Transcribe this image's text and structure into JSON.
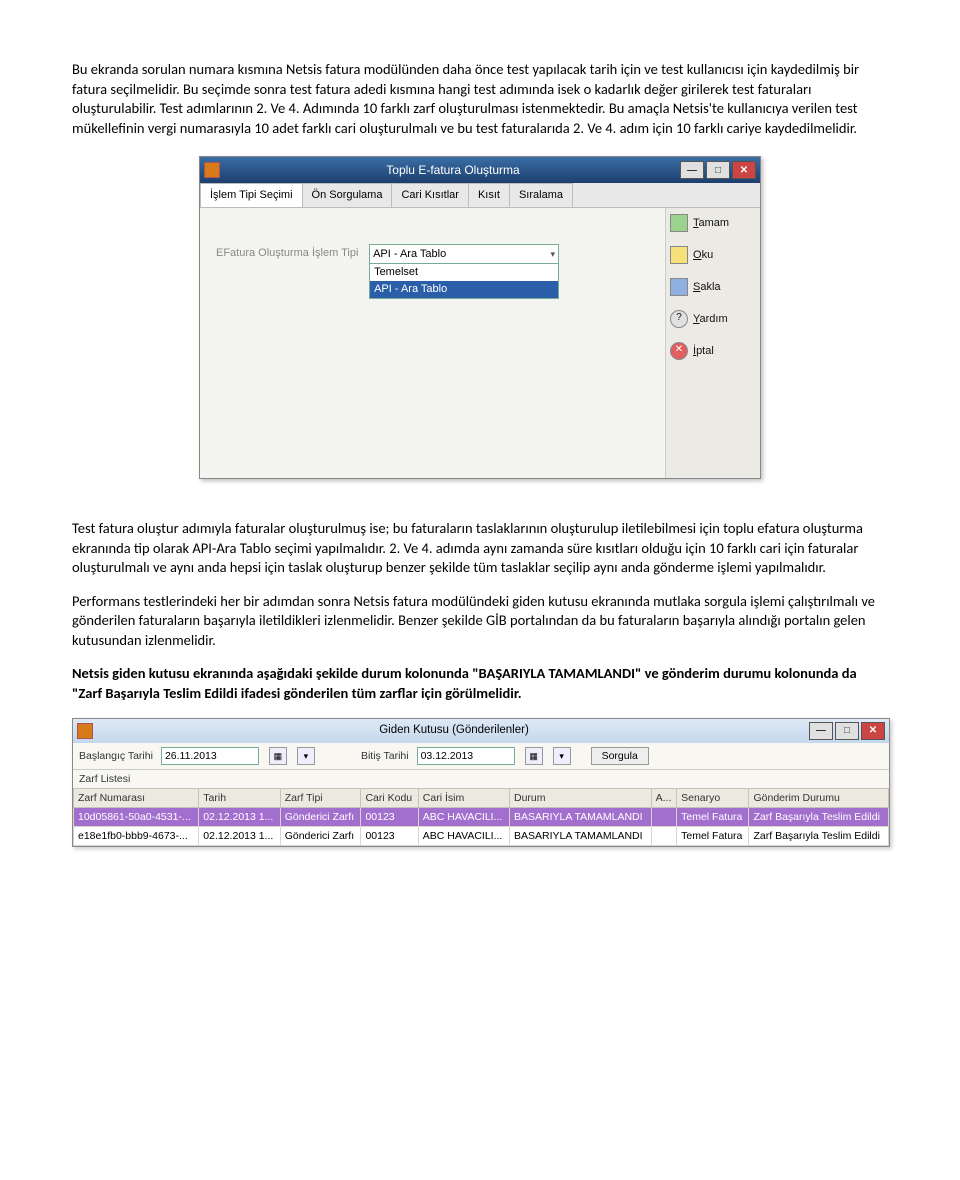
{
  "para1": "Bu ekranda sorulan numara kısmına Netsis fatura modülünden daha önce test yapılacak tarih için ve test kullanıcısı için kaydedilmiş bir fatura seçilmelidir. Bu seçimde sonra test fatura adedi kısmına hangi test adımında isek o kadarlık değer girilerek test faturaları oluşturulabilir. Test adımlarının 2. Ve 4. Adımında 10 farklı zarf oluşturulması istenmektedir. Bu amaçla Netsis'te kullanıcıya verilen test mükellefinin vergi numarasıyla 10 adet farklı cari oluşturulmalı ve bu test faturalarıda 2. Ve 4. adım için 10 farklı cariye kaydedilmelidir.",
  "win1": {
    "title": "Toplu E-fatura Oluşturma",
    "tabs": [
      "İşlem Tipi Seçimi",
      "Ön Sorgulama",
      "Cari Kısıtlar",
      "Kısıt",
      "Sıralama"
    ],
    "label": "EFatura Oluşturma İşlem Tipi",
    "combo_selected": "API - Ara Tablo",
    "combo_options": [
      "Temelset",
      "API - Ara Tablo"
    ],
    "sidebar": {
      "tamam_key": "T",
      "tamam": "amam",
      "oku_key": "O",
      "oku": "ku",
      "sakla_key": "S",
      "sakla": "akla",
      "yardim_key": "Y",
      "yardim": "ardım",
      "iptal_key": "İ",
      "iptal": "ptal"
    }
  },
  "para2": "Test fatura oluştur adımıyla faturalar oluşturulmuş ise; bu faturaların taslaklarının oluşturulup iletilebilmesi için toplu efatura oluşturma ekranında tip olarak API-Ara Tablo seçimi yapılmalıdır. 2. Ve 4. adımda aynı zamanda süre kısıtları olduğu için 10 farklı cari için faturalar oluşturulmalı ve aynı anda hepsi için taslak oluşturup benzer şekilde tüm taslaklar seçilip aynı anda gönderme işlemi yapılmalıdır.",
  "para3": "Performans testlerindeki her bir adımdan sonra Netsis fatura modülündeki giden kutusu ekranında mutlaka sorgula işlemi çalıştırılmalı ve gönderilen faturaların başarıyla iletildikleri izlenmelidir. Benzer şekilde GİB portalından da bu faturaların başarıyla alındığı portalın gelen kutusundan izlenmelidir.",
  "para4": "Netsis giden kutusu ekranında aşağıdaki şekilde durum kolonunda \"BAŞARIYLA TAMAMLANDI\" ve gönderim durumu kolonunda da \"Zarf Başarıyla Teslim Edildi ifadesi gönderilen tüm zarflar için görülmelidir.",
  "win2": {
    "title": "Giden Kutusu (Gönderilenler)",
    "f_start_label": "Başlangıç Tarihi",
    "f_start": "26.11.2013",
    "f_end_label": "Bitiş Tarihi",
    "f_end": "03.12.2013",
    "sorgula": "Sorgula",
    "list_title": "Zarf Listesi",
    "columns": [
      "Zarf Numarası",
      "Tarih",
      "Zarf Tipi",
      "Cari Kodu",
      "Cari İsim",
      "Durum",
      "A...",
      "Senaryo",
      "Gönderim Durumu"
    ],
    "rows": [
      {
        "sel": true,
        "c": [
          "10d05861-50a0-4531-...",
          "02.12.2013 1...",
          "Gönderici Zarfı",
          "00123",
          "ABC HAVACILI...",
          "BASARIYLA TAMAMLANDI",
          "",
          "Temel Fatura",
          "Zarf Başarıyla Teslim Edildi"
        ]
      },
      {
        "sel": false,
        "c": [
          "e18e1fb0-bbb9-4673-...",
          "02.12.2013 1...",
          "Gönderici Zarfı",
          "00123",
          "ABC HAVACILI...",
          "BASARIYLA TAMAMLANDI",
          "",
          "Temel Fatura",
          "Zarf Başarıyla Teslim Edildi"
        ]
      }
    ]
  }
}
